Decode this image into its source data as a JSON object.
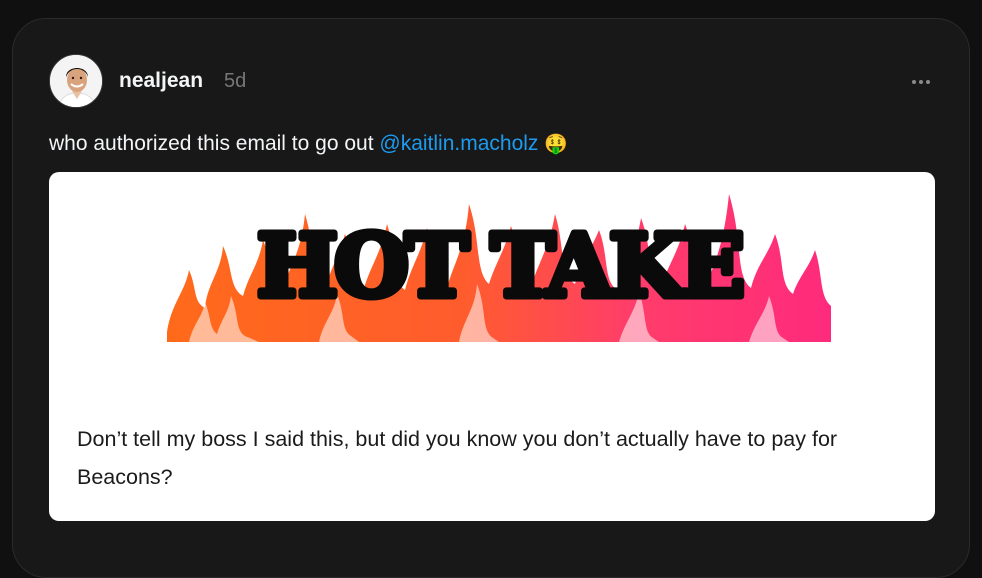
{
  "post": {
    "username": "nealjean",
    "timestamp": "5d",
    "text_before": "who authorized this email to go out ",
    "mention": "@kaitlin.macholz",
    "emoji": "🤑",
    "more_icon": "more-horizontal-icon"
  },
  "media": {
    "headline": "HOT TAKE",
    "caption": "Don’t tell my boss I said this, but did you know you don’t actually have to pay for Beacons?"
  },
  "colors": {
    "background": "#101010",
    "card": "#181818",
    "mention": "#1d9bf0",
    "flame_orange": "#ff5a1f",
    "flame_pink": "#ff2a7a"
  }
}
